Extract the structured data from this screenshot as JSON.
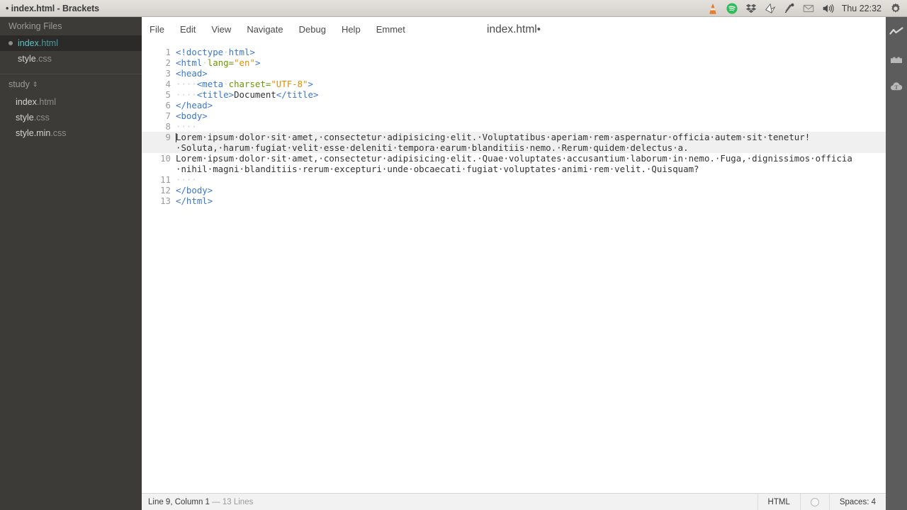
{
  "window": {
    "title": "• index.html - Brackets",
    "dirty_marker": "•"
  },
  "tray": {
    "icons": [
      "vlc-cone-icon",
      "spotify-icon",
      "dropbox-icon",
      "origami-bird-icon",
      "pen-tool-icon",
      "envelope-icon",
      "volume-icon"
    ],
    "clock": "Thu 22:32",
    "gear": "gear-icon"
  },
  "sidebar": {
    "working_files_header": "Working Files",
    "working_files": [
      {
        "name": "index",
        "ext": ".html",
        "active": true,
        "modified": true
      },
      {
        "name": "style",
        "ext": ".css",
        "active": false,
        "modified": false
      }
    ],
    "project_name": "study",
    "project_caret": "⇕",
    "tree": [
      {
        "name": "index",
        "ext": ".html"
      },
      {
        "name": "style",
        "ext": ".css"
      },
      {
        "name": "style.min",
        "ext": ".css"
      }
    ]
  },
  "menubar": {
    "items": [
      "File",
      "Edit",
      "View",
      "Navigate",
      "Debug",
      "Help",
      "Emmet"
    ]
  },
  "document": {
    "title": "index.html",
    "dirty": "•",
    "language": "HTML",
    "line_count": 13,
    "cursor_line": 9,
    "cursor_column": 1
  },
  "code": {
    "lines": [
      {
        "n": "1",
        "tokens": [
          {
            "t": "tag",
            "v": "<!doctype"
          },
          {
            "t": "ws",
            "v": "·"
          },
          {
            "t": "tag",
            "v": "html>"
          }
        ]
      },
      {
        "n": "2",
        "tokens": [
          {
            "t": "tag",
            "v": "<html"
          },
          {
            "t": "ws",
            "v": "·"
          },
          {
            "t": "attr",
            "v": "lang="
          },
          {
            "t": "str",
            "v": "\"en\""
          },
          {
            "t": "tag",
            "v": ">"
          }
        ]
      },
      {
        "n": "3",
        "tokens": [
          {
            "t": "tag",
            "v": "<head>"
          }
        ]
      },
      {
        "n": "4",
        "tokens": [
          {
            "t": "ws",
            "v": "····"
          },
          {
            "t": "tag",
            "v": "<meta"
          },
          {
            "t": "ws",
            "v": "·"
          },
          {
            "t": "attr",
            "v": "charset="
          },
          {
            "t": "str",
            "v": "\"UTF-8\""
          },
          {
            "t": "tag",
            "v": ">"
          }
        ]
      },
      {
        "n": "5",
        "tokens": [
          {
            "t": "ws",
            "v": "····"
          },
          {
            "t": "tag",
            "v": "<title>"
          },
          {
            "t": "txt",
            "v": "Document"
          },
          {
            "t": "tag",
            "v": "</title>"
          }
        ]
      },
      {
        "n": "6",
        "tokens": [
          {
            "t": "tag",
            "v": "</head>"
          }
        ]
      },
      {
        "n": "7",
        "tokens": [
          {
            "t": "tag",
            "v": "<body>"
          }
        ]
      },
      {
        "n": "8",
        "tokens": [
          {
            "t": "ws",
            "v": "····"
          }
        ]
      },
      {
        "n": "9",
        "active": true,
        "cursor": true,
        "tokens": [
          {
            "t": "txt",
            "v": "Lorem·ipsum·dolor·sit·amet,·consectetur·adipisicing·elit.·Voluptatibus·aperiam·rem·aspernatur·officia·autem·sit·tenetur!·Soluta,·harum·fugiat·velit·esse·deleniti·tempora·earum·blanditiis·nemo.·Rerum·quidem·delectus·a."
          }
        ]
      },
      {
        "n": "10",
        "tokens": [
          {
            "t": "txt",
            "v": "Lorem·ipsum·dolor·sit·amet,·consectetur·adipisicing·elit.·Quae·voluptates·accusantium·laborum·in·nemo.·Fuga,·dignissimos·officia·nihil·magni·blanditiis·rerum·excepturi·unde·obcaecati·fugiat·voluptates·animi·rem·velit.·Quisquam?"
          }
        ]
      },
      {
        "n": "11",
        "tokens": [
          {
            "t": "ws",
            "v": "····"
          }
        ]
      },
      {
        "n": "12",
        "tokens": [
          {
            "t": "tag",
            "v": "</body>"
          }
        ]
      },
      {
        "n": "13",
        "tokens": [
          {
            "t": "tag",
            "v": "</html>"
          }
        ]
      }
    ]
  },
  "statusbar": {
    "cursor_text": "Line 9, Column 1",
    "dash": "—",
    "lines_text": "13 Lines",
    "language": "HTML",
    "indent": "Spaces: 4"
  },
  "right_toolbar": {
    "icons": [
      "live-preview-icon",
      "extension-manager-icon",
      "cloud-icon"
    ]
  },
  "colors": {
    "accent_active_file": "#5fc1c9",
    "tag": "#3b77c9",
    "attribute": "#6a9900",
    "string": "#e08e00",
    "sidebar_bg": "#3c3b37",
    "toolbar_bg": "#5c5c5c"
  }
}
